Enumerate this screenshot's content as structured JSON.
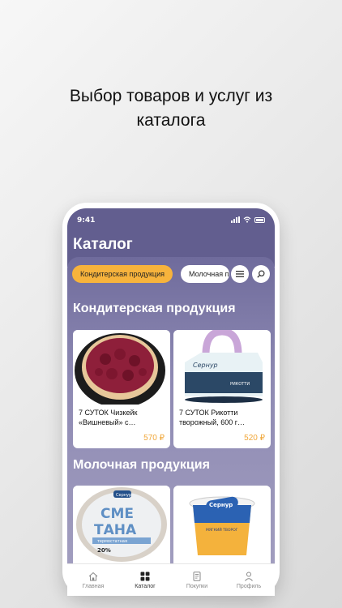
{
  "headline": {
    "line1": "Выбор товаров и услуг из",
    "line2": "каталога"
  },
  "status": {
    "time": "9:41"
  },
  "page": {
    "title": "Каталог"
  },
  "chips": {
    "active": "Кондитерская продукция",
    "next": "Молочная продукция"
  },
  "sections": [
    {
      "title": "Кондитерская продукция",
      "products": [
        {
          "name": "7 СУТОК Чизкейк «Вишневый» с…",
          "price": "570 ₽"
        },
        {
          "name": "7 СУТОК Рикотти творожный, 600 г…",
          "price": "520 ₽"
        }
      ]
    },
    {
      "title": "Молочная продукция",
      "products": [
        {
          "name": "Сметана термостатная 20%",
          "price": ""
        },
        {
          "name": "Сернур мягкий творог",
          "price": ""
        }
      ]
    }
  ],
  "product_images": {
    "cheesecake": {
      "text": ""
    },
    "ricotti": {
      "brand": "Сернур",
      "label": "РИКОТТИ"
    },
    "smetana": {
      "brand": "Сернур",
      "big1": "СМЕ",
      "big2": "ТАНА",
      "sub": "термостатная",
      "fat": "20%"
    },
    "tvorog": {
      "brand": "Сернур",
      "sub": "МЯГКИЙ ТВОРОГ"
    }
  },
  "tabs": [
    {
      "label": "Главная",
      "icon": "home-icon"
    },
    {
      "label": "Каталог",
      "icon": "grid-icon"
    },
    {
      "label": "Покупки",
      "icon": "receipt-icon"
    },
    {
      "label": "Профиль",
      "icon": "person-icon"
    }
  ],
  "colors": {
    "header": "#625e8f",
    "accent": "#f7b33c",
    "price": "#f0a73a"
  }
}
